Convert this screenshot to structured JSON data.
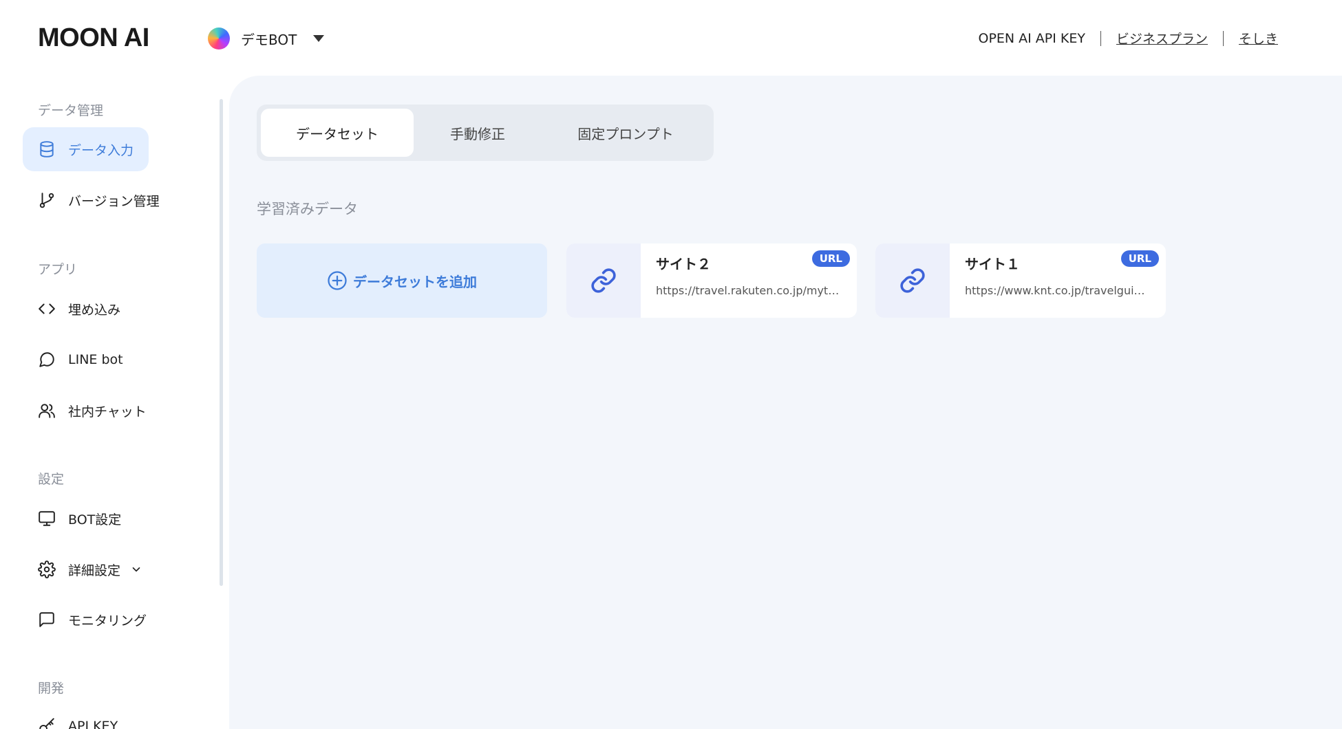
{
  "app": {
    "logo": "MOON AI"
  },
  "bot_switcher": {
    "name": "デモBOT"
  },
  "header_links": {
    "api_key": "OPEN AI API KEY",
    "business_plan": "ビジネスプラン",
    "sokushiki": "そしき"
  },
  "sidebar": {
    "sections": [
      {
        "label": "データ管理"
      },
      {
        "label": "アプリ"
      },
      {
        "label": "設定"
      },
      {
        "label": "開発"
      }
    ],
    "items": [
      {
        "label": "データ入力",
        "icon": "database-icon",
        "active": true
      },
      {
        "label": "バージョン管理",
        "icon": "git-branch-icon"
      },
      {
        "label": "埋め込み",
        "icon": "code-icon"
      },
      {
        "label": "LINE bot",
        "icon": "chat-bubble-icon"
      },
      {
        "label": "社内チャット",
        "icon": "users-icon"
      },
      {
        "label": "BOT設定",
        "icon": "monitor-icon"
      },
      {
        "label": "詳細設定",
        "icon": "gear-icon"
      },
      {
        "label": "モニタリング",
        "icon": "message-square-icon"
      },
      {
        "label": "API KEY",
        "icon": "key-icon"
      }
    ]
  },
  "main": {
    "tabs": [
      {
        "label": "データセット",
        "active": true
      },
      {
        "label": "手動修正"
      },
      {
        "label": "固定プロンプト"
      }
    ],
    "section_title": "学習済みデータ",
    "add_dataset_label": "データセットを追加",
    "datasets": [
      {
        "name": "サイト２",
        "url": "https://travel.rakuten.co.jp/mytrip/ranking/spot-koyo",
        "badge": "URL"
      },
      {
        "name": "サイト１",
        "url": "https://www.knt.co.jp/travelguide/autumn/koyo",
        "badge": "URL"
      }
    ]
  },
  "colors": {
    "accent": "#3d7bd9",
    "badge": "#3d6be0",
    "main_bg": "#f3f6fb",
    "active_nav_bg": "#e4efff"
  }
}
